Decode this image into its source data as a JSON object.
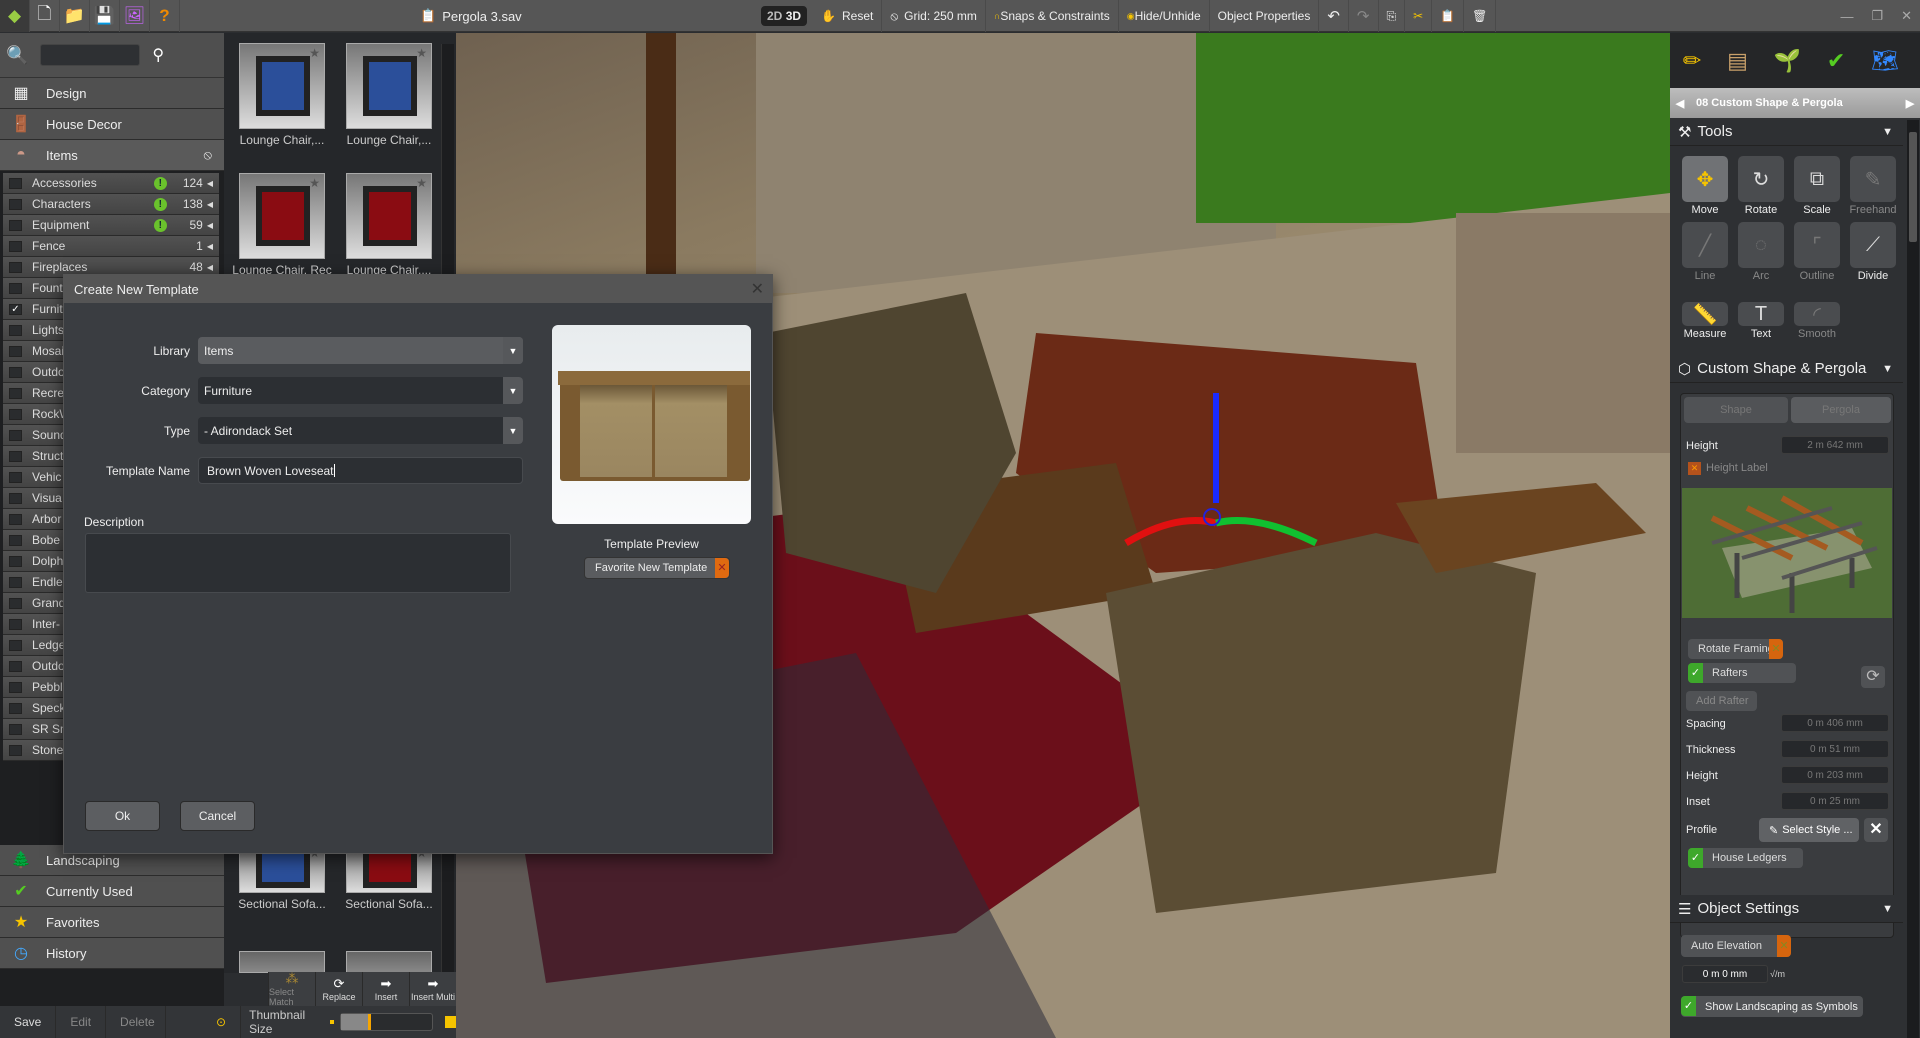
{
  "topbar": {
    "file_name": "Pergola 3.sav",
    "mode_2d": "2D",
    "mode_3d": "3D",
    "reset": "Reset",
    "grid": "Grid: 250 mm",
    "snaps": "Snaps & Constraints",
    "hide_unhide": "Hide/Unhide",
    "object_properties": "Object Properties",
    "icons": [
      "app-logo-icon",
      "new-file-icon",
      "open-folder-icon",
      "save-icon",
      "render-image-icon",
      "help-icon"
    ]
  },
  "sidebar": {
    "search_placeholder": "",
    "categories": [
      {
        "label": "Design",
        "icon": "design-icon"
      },
      {
        "label": "House Decor",
        "icon": "house-decor-icon"
      },
      {
        "label": "Items",
        "icon": "items-icon"
      }
    ],
    "subcategories": [
      {
        "label": "Accessories",
        "count": "124",
        "alert": true,
        "checked": false
      },
      {
        "label": "Characters",
        "count": "138",
        "alert": true,
        "checked": false
      },
      {
        "label": "Equipment",
        "count": "59",
        "alert": true,
        "checked": false
      },
      {
        "label": "Fence",
        "count": "1",
        "alert": false,
        "checked": false
      },
      {
        "label": "Fireplaces",
        "count": "48",
        "alert": false,
        "checked": false
      },
      {
        "label": "Fount",
        "checked": false
      },
      {
        "label": "Furnit",
        "checked": true
      },
      {
        "label": "Lights",
        "checked": false
      },
      {
        "label": "Mosai",
        "checked": false
      },
      {
        "label": "Outdo",
        "checked": false
      },
      {
        "label": "Recre",
        "checked": false
      },
      {
        "label": "RockW",
        "checked": false
      },
      {
        "label": "Sound",
        "checked": false
      },
      {
        "label": "Struct",
        "checked": false
      },
      {
        "label": "Vehic",
        "checked": false
      },
      {
        "label": "Visua",
        "checked": false
      },
      {
        "label": "Arbor",
        "checked": false
      },
      {
        "label": "Bobe",
        "checked": false
      },
      {
        "label": "Dolph",
        "checked": false
      },
      {
        "label": "Endle",
        "checked": false
      },
      {
        "label": "Grand",
        "checked": false
      },
      {
        "label": "Inter-",
        "checked": false
      },
      {
        "label": "Ledge",
        "checked": false
      },
      {
        "label": "Outdo",
        "checked": false
      },
      {
        "label": "Pebble",
        "checked": false
      },
      {
        "label": "Speck",
        "checked": false
      },
      {
        "label": "SR Sm",
        "checked": false
      },
      {
        "label": "Stone",
        "checked": false
      }
    ],
    "bottom_categories": [
      {
        "label": "Landscaping",
        "icon": "tree-icon"
      },
      {
        "label": "Currently Used",
        "icon": "checkmark-icon"
      },
      {
        "label": "Favorites",
        "icon": "star-icon"
      },
      {
        "label": "History",
        "icon": "clock-icon"
      }
    ]
  },
  "thumbnails": [
    {
      "label": "Lounge Chair,...",
      "color": "#2b4f9a"
    },
    {
      "label": "Lounge Chair,...",
      "color": "#2b4f9a"
    },
    {
      "label": "Lounge Chair, Rec",
      "color": "#8a0c12"
    },
    {
      "label": "Lounge Chair,...",
      "color": "#8a0c12"
    },
    {
      "label": "Sectional Sofa...",
      "color": "#2b4f9a"
    },
    {
      "label": "Sectional Sofa...",
      "color": "#8a0c12"
    }
  ],
  "action_bar": {
    "select_match": "Select Match",
    "replace": "Replace",
    "insert": "Insert",
    "insert_multi": "Insert Multi"
  },
  "bottom_bar": {
    "save": "Save",
    "edit": "Edit",
    "delete": "Delete",
    "thumbnail_size": "Thumbnail Size",
    "thumbnail_size_value": 0.3
  },
  "dialog": {
    "title": "Create New Template",
    "library_label": "Library",
    "library_value": "Items",
    "category_label": "Category",
    "category_value": "Furniture",
    "type_label": "Type",
    "type_value": "- Adirondack Set",
    "name_label": "Template Name",
    "name_value": "Brown Woven Loveseat",
    "description_label": "Description",
    "description_value": "",
    "preview_label": "Template Preview",
    "favorite_label": "Favorite New Template",
    "ok": "Ok",
    "cancel": "Cancel"
  },
  "right_panel": {
    "tab_icons": [
      "pencil-icon",
      "brick-icon",
      "plant-icon",
      "check-icon",
      "map-icon"
    ],
    "breadcrumb": "08 Custom Shape & Pergola",
    "tools_title": "Tools",
    "tools": [
      {
        "label": "Move",
        "glyph": "✥",
        "enabled": true,
        "selected": true
      },
      {
        "label": "Rotate",
        "glyph": "↻",
        "enabled": true
      },
      {
        "label": "Scale",
        "glyph": "⧉",
        "enabled": true
      },
      {
        "label": "Freehand",
        "glyph": "✎",
        "enabled": false
      },
      {
        "label": "Line",
        "glyph": "╱",
        "enabled": false
      },
      {
        "label": "Arc",
        "glyph": "◌",
        "enabled": false
      },
      {
        "label": "Outline",
        "glyph": "⌜",
        "enabled": false
      },
      {
        "label": "Divide",
        "glyph": "⟋",
        "enabled": true
      },
      {
        "label": "Measure",
        "glyph": "📏",
        "enabled": true
      },
      {
        "label": "Text",
        "glyph": "T",
        "enabled": true
      },
      {
        "label": "Smooth",
        "glyph": "◜",
        "enabled": false
      }
    ],
    "pergola_title": "Custom Shape & Pergola",
    "shape_tab": "Shape",
    "pergola_tab": "Pergola",
    "height_label": "Height",
    "height_value": "2 m 642 mm",
    "height_label_toggle": "Height Label",
    "rotate_framing": "Rotate Framing",
    "rafters": "Rafters",
    "add_rafter": "Add Rafter",
    "spacing_label": "Spacing",
    "spacing_value": "0 m 406 mm",
    "thickness_label": "Thickness",
    "thickness_value": "0 m 51 mm",
    "rafter_height_label": "Height",
    "rafter_height_value": "0 m 203 mm",
    "inset_label": "Inset",
    "inset_value": "0 m 25 mm",
    "profile_label": "Profile",
    "select_style": "Select Style ...",
    "house_ledgers": "House Ledgers",
    "object_settings_title": "Object Settings",
    "auto_elevation": "Auto Elevation",
    "elevation_value": "0 m 0 mm",
    "unit_toggle": "√/m",
    "show_landscaping": "Show Landscaping as Symbols"
  }
}
